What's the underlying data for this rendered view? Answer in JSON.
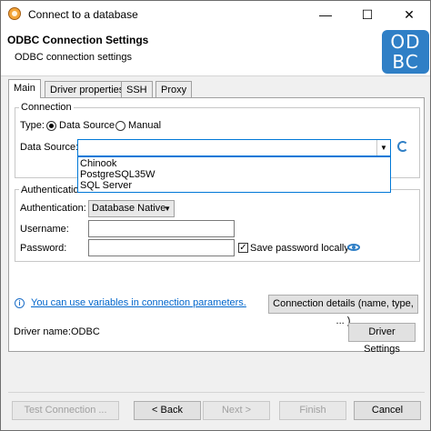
{
  "window": {
    "title": "Connect to a database",
    "minimize": "—",
    "maximize": "☐",
    "close": "✕"
  },
  "header": {
    "title": "ODBC Connection Settings",
    "subtitle": "ODBC connection settings",
    "logo_line1": "ODBC",
    "logo_top": "OD",
    "logo_bottom": "BC"
  },
  "tabs": [
    {
      "label": "Main"
    },
    {
      "label": "Driver properties"
    },
    {
      "label": "SSH"
    },
    {
      "label": "Proxy"
    }
  ],
  "connection": {
    "group_label": "Connection",
    "type_label": "Type:",
    "type_options": [
      "Data Source",
      "Manual"
    ],
    "selected_type": "Data Source",
    "data_source_label": "Data Source:",
    "data_source_value": "",
    "data_source_options": [
      "Chinook",
      "PostgreSQL35W",
      "SQL Server"
    ]
  },
  "authentication": {
    "group_label": "Authentication",
    "auth_label": "Authentication:",
    "auth_value": "Database Native",
    "username_label": "Username:",
    "username_value": "",
    "password_label": "Password:",
    "password_value": "",
    "save_password_label": "Save password locally",
    "save_password_checked": true
  },
  "variables_link": "You can use variables in connection parameters.",
  "connection_details_button": "Connection details (name, type, ... )",
  "driver": {
    "label": "Driver name:",
    "value": "ODBC",
    "settings_button": "Driver Settings"
  },
  "footer": {
    "test_connection": "Test Connection ...",
    "back": "< Back",
    "next": "Next >",
    "finish": "Finish",
    "cancel": "Cancel"
  },
  "colors": {
    "accent": "#0078d7",
    "logo": "#2f7fc6",
    "link": "#0066cc"
  }
}
